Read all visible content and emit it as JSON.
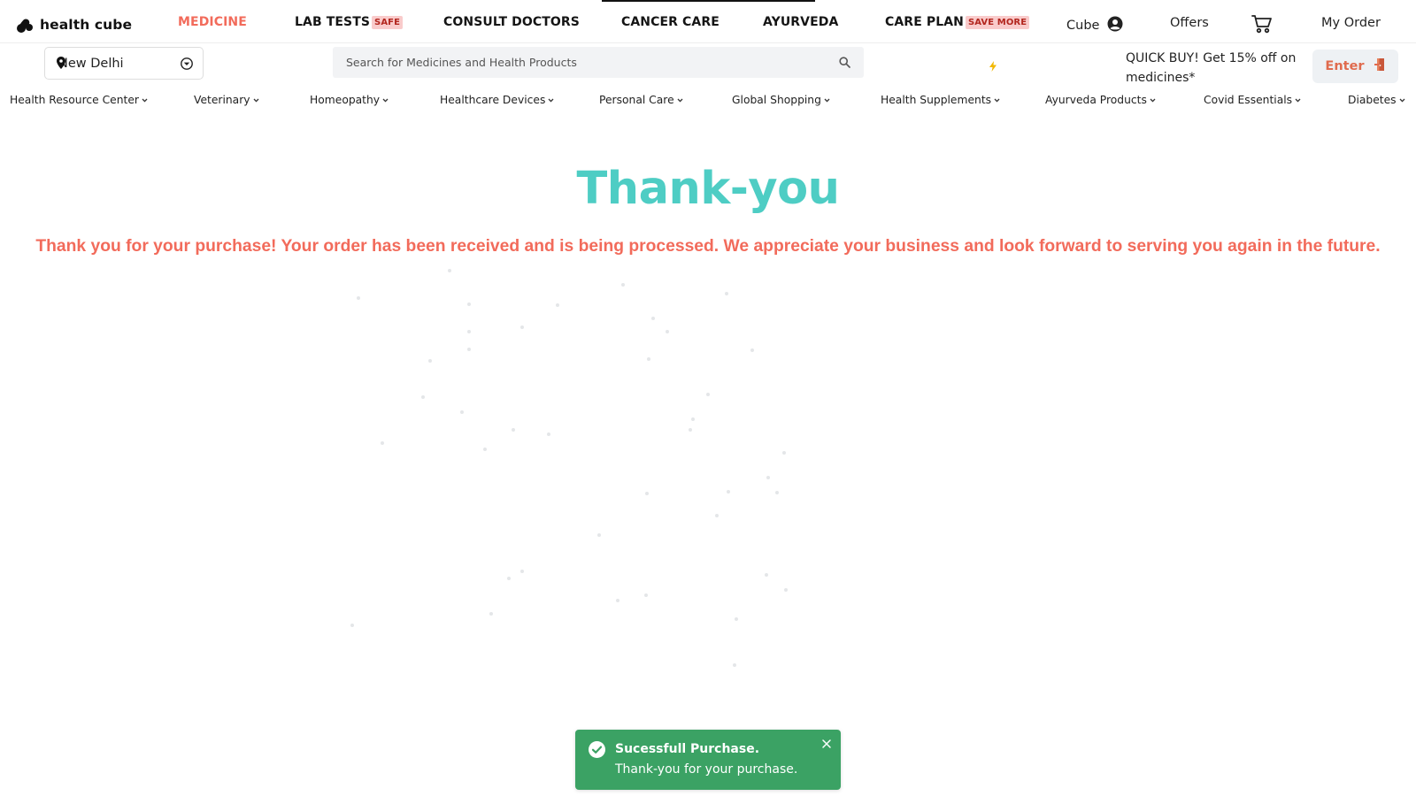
{
  "header": {
    "logo_text": "health cube",
    "nav": [
      {
        "label": "MEDICINE",
        "badge": ""
      },
      {
        "label": "LAB TESTS",
        "badge": "SAFE"
      },
      {
        "label": "CONSULT DOCTORS",
        "badge": ""
      },
      {
        "label": "CANCER CARE",
        "badge": ""
      },
      {
        "label": "AYURVEDA",
        "badge": ""
      },
      {
        "label": "CARE PLAN",
        "badge": "SAVE MORE"
      }
    ],
    "user_label": "Cube",
    "offers_label": "Offers",
    "my_order_label": "My Order",
    "accent_color": "#f26b5b"
  },
  "subheader": {
    "location": "New Delhi",
    "search_placeholder": "Search for Medicines and Health Products",
    "quick_buy": "QUICK BUY! Get 15% off on medicines*",
    "enter_label": "Enter"
  },
  "categories": [
    "Health Resource Center",
    "Veterinary",
    "Homeopathy",
    "Healthcare Devices",
    "Personal Care",
    "Global Shopping",
    "Health Supplements",
    "Ayurveda Products",
    "Covid Essentials",
    "Diabetes"
  ],
  "main": {
    "title": "Thank-you",
    "message": "Thank you for your purchase! Your order has been received and is being processed. We appreciate your business and look forward to serving you again in the future.",
    "title_color": "#4ecdc4"
  },
  "toast": {
    "title": "Sucessfull Purchase.",
    "body": "Thank-you for your purchase.",
    "color": "#3ba264"
  },
  "icons": [
    "logo-icon",
    "user-icon",
    "cart-icon",
    "location-pin-icon",
    "dropdown-icon",
    "search-icon",
    "bolt-icon",
    "exit-door-icon",
    "chevron-down-icon",
    "check-circle-icon",
    "close-icon"
  ]
}
